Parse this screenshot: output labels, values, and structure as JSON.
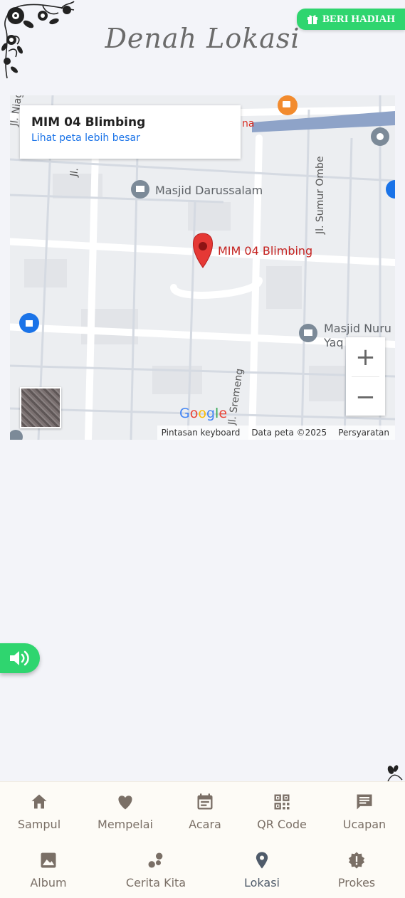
{
  "header": {
    "title": "Denah Lokasi",
    "gift_button_label": "BERI HADIAH"
  },
  "map": {
    "place_name": "MIM 04 Blimbing",
    "larger_map_link": "Lihat peta lebih besar",
    "pin_label": "MIM 04 Blimbing",
    "poi": [
      "Masjid Darussalam",
      "Masjid Nuru",
      "Yaq"
    ],
    "streets": [
      "Jl. Niaga",
      "Jl. Sumur Ombe",
      "Jl. Sremeng",
      "Jl.",
      "na"
    ],
    "zoom_in": "+",
    "zoom_out": "−",
    "google": "Google",
    "attribution": {
      "shortcuts": "Pintasan keyboard",
      "data": "Data peta ©2025",
      "terms": "Persyaratan"
    }
  },
  "nav": {
    "row1": [
      {
        "label": "Sampul",
        "icon": "home-icon"
      },
      {
        "label": "Mempelai",
        "icon": "heart-icon"
      },
      {
        "label": "Acara",
        "icon": "calendar-icon"
      },
      {
        "label": "QR Code",
        "icon": "qr-code-icon"
      },
      {
        "label": "Ucapan",
        "icon": "comment-icon"
      }
    ],
    "row2": [
      {
        "label": "Album",
        "icon": "image-icon"
      },
      {
        "label": "Cerita Kita",
        "icon": "bubbles-icon"
      },
      {
        "label": "Lokasi",
        "icon": "location-pin-icon"
      },
      {
        "label": "Prokes",
        "icon": "alert-badge-icon"
      }
    ],
    "active": "Lokasi"
  },
  "colors": {
    "accent_green": "#2fd56f",
    "nav_icon": "#7a6f66",
    "nav_active": "#4f5b6a",
    "pin_red": "#e53935",
    "link_blue": "#1a73e8"
  }
}
